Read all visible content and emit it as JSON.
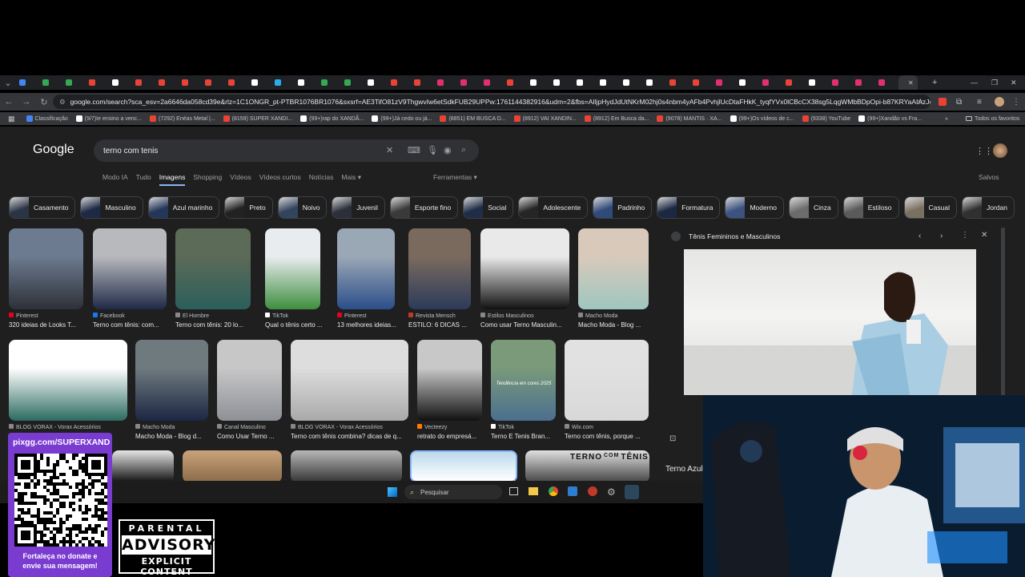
{
  "browser": {
    "url": "google.com/search?sca_esv=2a6646da058cd39e&rlz=1C1ONGR_pt-PTBR1076BR1076&sxsrf=AE3TifO81zV9ThgwvIw6etSdkFUB29UPPw:1761144382916&udm=2&fbs=AIljpHydJdUtNKrM02hj0s4nbm4yAFb4PvhjlUcDtaFHkK_tyqfYVx0lCBcCX38sg5LqgWMbBDpOpi-b87KRYaAIAzJqMvLYsSu7hLLf25XWG1b...",
    "tab_colors": [
      "#4285f4",
      "#34a853",
      "#34a853",
      "#ea4335",
      "#ffffff",
      "#ea4335",
      "#ea4335",
      "#ea4335",
      "#ea4335",
      "#ea4335",
      "#ffffff",
      "#2aabee",
      "#ffffff",
      "#34a853",
      "#34a853",
      "#ffffff",
      "#ea4335",
      "#ea4335",
      "#e1306c",
      "#e1306c",
      "#e1306c",
      "#ea4335",
      "#ffffff",
      "#ffffff",
      "#ffffff",
      "#ffffff",
      "#ffffff",
      "#ffffff",
      "#ea4335",
      "#ea4335",
      "#e1306c",
      "#ffffff",
      "#e1306c",
      "#ea4335",
      "#ffffff",
      "#e1306c",
      "#e1306c",
      "#e1306c"
    ],
    "bookmarks": [
      {
        "label": "Classificação",
        "color": "#4285f4"
      },
      {
        "label": "(9/7)Ie ensino a venc...",
        "color": "#ffffff"
      },
      {
        "label": "(7292) Enéas Metal |...",
        "color": "#ea4335"
      },
      {
        "label": "(8159) SUPER XANDI...",
        "color": "#ea4335"
      },
      {
        "label": "(99+)rap do XANDÃ...",
        "color": "#ffffff"
      },
      {
        "label": "(99+)Já cedo ou já...",
        "color": "#ffffff"
      },
      {
        "label": "(8851) EM BUSCA D...",
        "color": "#ea4335"
      },
      {
        "label": "(8912) VAI XANDIN...",
        "color": "#ea4335"
      },
      {
        "label": "(8912) Em Busca da...",
        "color": "#ea4335"
      },
      {
        "label": "(9078) MANTIS · XA...",
        "color": "#ea4335"
      },
      {
        "label": "(99+)Os vídeos de c...",
        "color": "#ffffff"
      },
      {
        "label": "(9338) YouTube",
        "color": "#ea4335"
      },
      {
        "label": "(99+)Xandão vs Fra...",
        "color": "#ffffff"
      }
    ],
    "all_bookmarks": "Todos os favoritos"
  },
  "google": {
    "logo": "Google",
    "query": "terno com tenis",
    "tabs": [
      "Modo IA",
      "Tudo",
      "Imagens",
      "Shopping",
      "Vídeos",
      "Vídeos curtos",
      "Notícias",
      "Mais ▾"
    ],
    "active_tab": "Imagens",
    "tools": "Ferramentas ▾",
    "saved": "Salvos",
    "chips": [
      "Casamento",
      "Masculino",
      "Azul marinho",
      "Preto",
      "Noivo",
      "Juvenil",
      "Esporte fino",
      "Social",
      "Adolescente",
      "Padrinho",
      "Formatura",
      "Moderno",
      "Cinza",
      "Estiloso",
      "Casual",
      "Jordan"
    ]
  },
  "results_row1": [
    {
      "source": "Pinterest",
      "title": "320 ideias de Looks T...",
      "src_color": "#e60023"
    },
    {
      "source": "Facebook",
      "title": "Terno com tênis: com...",
      "src_color": "#1877f2"
    },
    {
      "source": "El Hombre",
      "title": "Terno com tênis: 20 lo...",
      "src_color": "#888888"
    },
    {
      "source": "TikTok",
      "title": "Qual o tênis certo ...",
      "src_color": "#ffffff"
    },
    {
      "source": "Pinterest",
      "title": "13 melhores ideias...",
      "src_color": "#e60023"
    },
    {
      "source": "Revista Mensch",
      "title": "ESTILO: 6 DICAS ...",
      "src_color": "#c0392b"
    },
    {
      "source": "Estilos Masculinos",
      "title": "Como usar Terno Masculin...",
      "src_color": "#888888"
    },
    {
      "source": "Macho Moda",
      "title": "Macho Moda - Blog ...",
      "src_color": "#888888"
    }
  ],
  "results_row2": [
    {
      "source": "BLOG VORAX - Vorax Acessórios",
      "title": "",
      "src_color": "#888888"
    },
    {
      "source": "Macho Moda",
      "title": "Macho Moda - Blog d...",
      "src_color": "#888888"
    },
    {
      "source": "Canal Masculino",
      "title": "Como Usar Terno ...",
      "src_color": "#888888"
    },
    {
      "source": "BLOG VORAX - Vorax Acessórios",
      "title": "Terno com tênis combina? dicas de q...",
      "src_color": "#888888"
    },
    {
      "source": "Vecteezy",
      "title": "retrato do empresá...",
      "src_color": "#ff7a00"
    },
    {
      "source": "TikTok",
      "title": "Terno E Tenis Bran...",
      "src_color": "#ffffff"
    },
    {
      "source": "Wix.com",
      "title": "Terno com tênis, porque ...",
      "src_color": "#888888"
    }
  ],
  "thumb_text": {
    "tendencia": "Tendência em cores 2025",
    "terno": "TERNO",
    "com": "COM",
    "tenis": "TÊNIS"
  },
  "panel": {
    "source_title": "Tênis Femininos e Masculinos",
    "caption": "Terno Azul"
  },
  "taskbar": {
    "search": "Pesquisar"
  },
  "overlay": {
    "pix_url": "pixgg.com/SUPERXAND",
    "pix_message_line1": "Fortaleça no donate e",
    "pix_message_line2": "envie sua mensagem!",
    "advisory_top": "PARENTAL",
    "advisory_main": "ADVISORY",
    "advisory_bottom": "EXPLICIT CONTENT"
  }
}
